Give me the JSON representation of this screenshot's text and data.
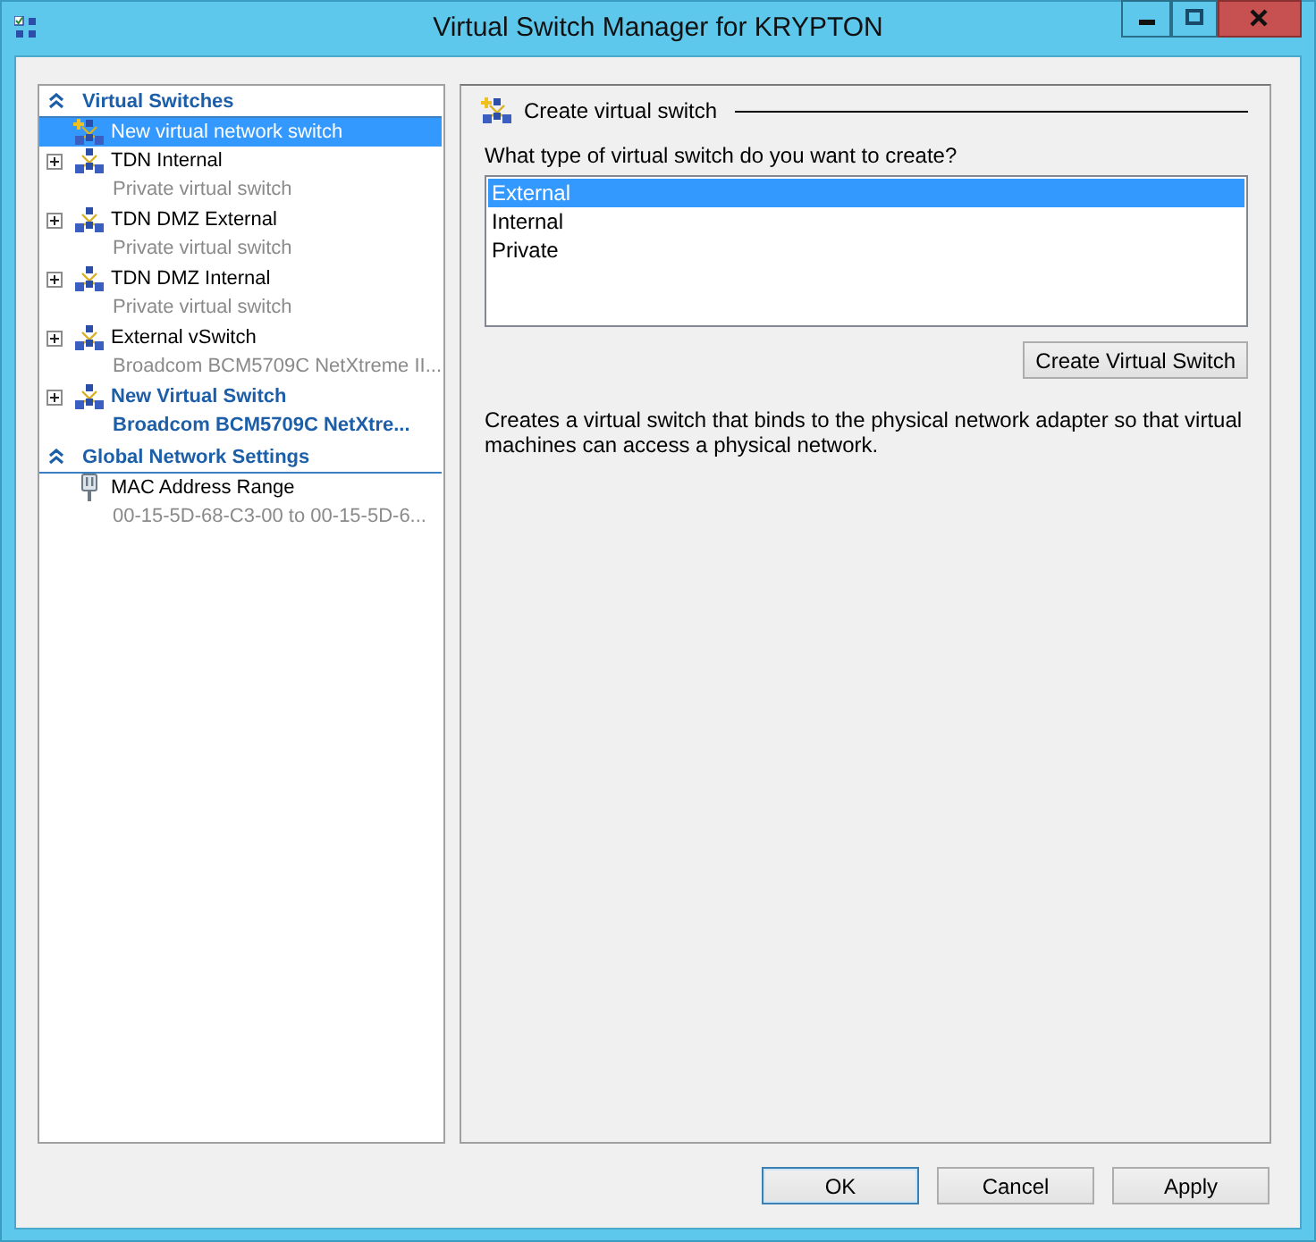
{
  "window": {
    "title": "Virtual Switch Manager for KRYPTON"
  },
  "navigator": {
    "sections": [
      {
        "title": "Virtual Switches",
        "expanded": true,
        "items": [
          {
            "kind": "new",
            "name": "New virtual network switch",
            "selected": true,
            "expandable": false,
            "emphasized": false
          },
          {
            "kind": "switch",
            "name": "TDN Internal",
            "detail": "Private virtual switch",
            "selected": false,
            "expandable": true,
            "emphasized": false
          },
          {
            "kind": "switch",
            "name": "TDN DMZ External",
            "detail": "Private virtual switch",
            "selected": false,
            "expandable": true,
            "emphasized": false
          },
          {
            "kind": "switch",
            "name": "TDN DMZ Internal",
            "detail": "Private virtual switch",
            "selected": false,
            "expandable": true,
            "emphasized": false
          },
          {
            "kind": "switch",
            "name": "External vSwitch",
            "detail": "Broadcom BCM5709C NetXtreme II...",
            "selected": false,
            "expandable": true,
            "emphasized": false
          },
          {
            "kind": "switch",
            "name": "New Virtual Switch",
            "detail": "Broadcom BCM5709C NetXtre...",
            "selected": false,
            "expandable": true,
            "emphasized": true
          }
        ]
      },
      {
        "title": "Global Network Settings",
        "expanded": true,
        "items": [
          {
            "kind": "mac",
            "name": "MAC Address Range",
            "detail": "00-15-5D-68-C3-00 to 00-15-5D-6...",
            "selected": false,
            "expandable": false,
            "emphasized": false
          }
        ]
      }
    ]
  },
  "detail": {
    "heading": "Create virtual switch",
    "question": "What type of virtual switch do you want to create?",
    "switch_types": [
      {
        "label": "External",
        "selected": true
      },
      {
        "label": "Internal",
        "selected": false
      },
      {
        "label": "Private",
        "selected": false
      }
    ],
    "create_button": "Create Virtual Switch",
    "description": "Creates a virtual switch that binds to the physical network adapter so that virtual machines can access a physical network."
  },
  "buttons": [
    {
      "label": "OK",
      "default": true
    },
    {
      "label": "Cancel",
      "default": false
    },
    {
      "label": "Apply",
      "default": false
    }
  ]
}
